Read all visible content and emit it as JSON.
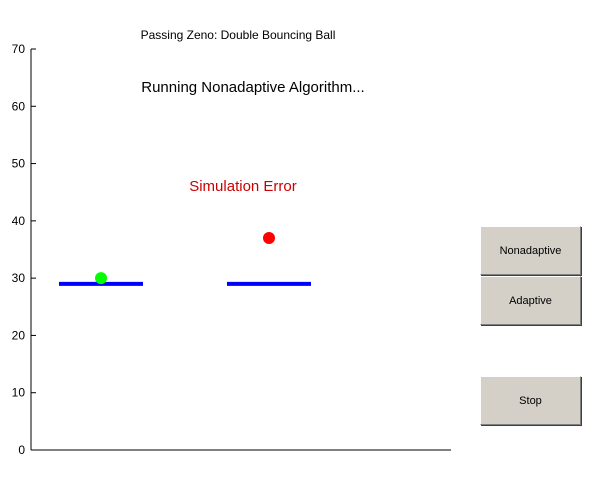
{
  "figure": {
    "title": "Passing Zeno: Double Bouncing Ball",
    "status_text": "Running Nonadaptive Algorithm...",
    "error_text": "Simulation Error",
    "colors": {
      "error": "#cc0000",
      "platform": "#0000ff",
      "ball_left": "#00ff00",
      "ball_right": "#ff0000",
      "button_face": "#d4d0c8"
    }
  },
  "chart_data": {
    "type": "scatter",
    "ylim": [
      0,
      70
    ],
    "yticks": [
      0,
      10,
      20,
      30,
      40,
      50,
      60,
      70
    ],
    "xticks": [],
    "platforms": [
      {
        "x": [
          1,
          4
        ],
        "y": 29
      },
      {
        "x": [
          7,
          10
        ],
        "y": 29
      }
    ],
    "balls": [
      {
        "x": 2.5,
        "y": 30,
        "color": "#00ff00"
      },
      {
        "x": 8.5,
        "y": 37,
        "color": "#ff0000"
      }
    ],
    "xlim": [
      0,
      15
    ]
  },
  "controls": {
    "nonadaptive_label": "Nonadaptive",
    "adaptive_label": "Adaptive",
    "stop_label": "Stop"
  }
}
